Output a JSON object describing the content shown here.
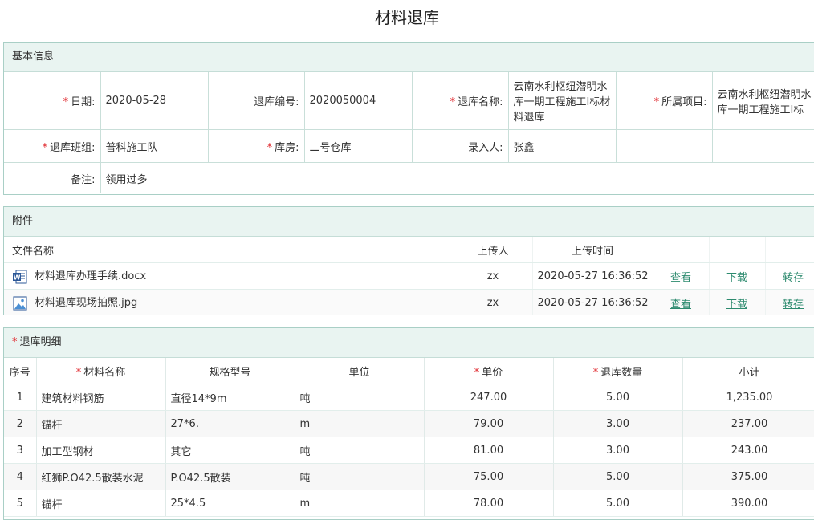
{
  "page_title": "材料退库",
  "basic": {
    "section_title": "基本信息",
    "date_label": "日期:",
    "date_value": "2020-05-28",
    "code_label": "退库编号:",
    "code_value": "2020050004",
    "name_label": "退库名称:",
    "name_value": "云南水利枢纽潜明水库一期工程施工I标材料退库",
    "project_label": "所属项目:",
    "project_value": "云南水利枢纽潜明水库一期工程施工I标",
    "team_label": "退库班组:",
    "team_value": "普科施工队",
    "warehouse_label": "库房:",
    "warehouse_value": "二号仓库",
    "entry_label": "录入人:",
    "entry_value": "张鑫",
    "remark_label": "备注:",
    "remark_value": "领用过多"
  },
  "attachments": {
    "section_title": "附件",
    "headers": {
      "name": "文件名称",
      "uploader": "上传人",
      "time": "上传时间"
    },
    "files": [
      {
        "name": "材料退库办理手续.docx",
        "icon": "word-doc-icon",
        "uploader": "zx",
        "time": "2020-05-27 16:36:52",
        "view": "查看",
        "download": "下载",
        "transfer": "转存"
      },
      {
        "name": "材料退库现场拍照.jpg",
        "icon": "image-file-icon",
        "uploader": "zx",
        "time": "2020-05-27 16:36:52",
        "view": "查看",
        "download": "下载",
        "transfer": "转存"
      }
    ]
  },
  "details": {
    "section_title": "退库明细",
    "headers": {
      "seq": "序号",
      "material": "材料名称",
      "spec": "规格型号",
      "unit": "单位",
      "price": "单价",
      "qty": "退库数量",
      "subtotal": "小计"
    },
    "rows": [
      {
        "seq": "1",
        "material": "建筑材料钢筋",
        "spec": "直径14*9m",
        "unit": "吨",
        "price": "247.00",
        "qty": "5.00",
        "subtotal": "1,235.00"
      },
      {
        "seq": "2",
        "material": "锚杆",
        "spec": "27*6.",
        "unit": "m",
        "price": "79.00",
        "qty": "3.00",
        "subtotal": "237.00"
      },
      {
        "seq": "3",
        "material": "加工型钢材",
        "spec": "其它",
        "unit": "吨",
        "price": "81.00",
        "qty": "3.00",
        "subtotal": "243.00"
      },
      {
        "seq": "4",
        "material": "红狮P.O42.5散装水泥",
        "spec": "P.O42.5散装",
        "unit": "吨",
        "price": "75.00",
        "qty": "5.00",
        "subtotal": "375.00"
      },
      {
        "seq": "5",
        "material": "锚杆",
        "spec": "25*4.5",
        "unit": "m",
        "price": "78.00",
        "qty": "5.00",
        "subtotal": "390.00"
      }
    ]
  },
  "colors": {
    "header_bg": "#e9f4f1",
    "border": "#a9cfc6",
    "required": "#e0282e",
    "link": "#2c8a6e"
  }
}
